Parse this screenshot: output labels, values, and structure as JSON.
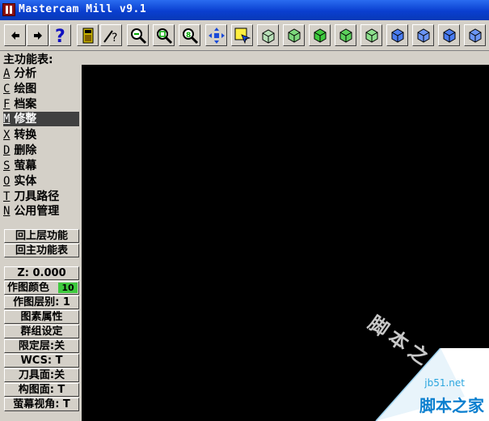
{
  "window": {
    "title": "Mastercam Mill v9.1"
  },
  "toolbar": {
    "buttons": [
      {
        "name": "back-button",
        "icon": "arrow-left-icon"
      },
      {
        "name": "forward-button",
        "icon": "arrow-right-icon"
      },
      {
        "name": "help-button",
        "icon": "question-icon"
      },
      {
        "name": "calculator-button",
        "icon": "calculator-icon"
      },
      {
        "name": "analyze-button",
        "icon": "analyze-icon"
      },
      {
        "name": "zoom-out-button",
        "icon": "zoom-out-icon"
      },
      {
        "name": "zoom-window-button",
        "icon": "zoom-window-icon"
      },
      {
        "name": "zoom-fit-button",
        "icon": "zoom-fit-icon"
      },
      {
        "name": "pan-button",
        "icon": "pan-icon"
      },
      {
        "name": "select-button",
        "icon": "select-icon"
      },
      {
        "name": "rotate-button",
        "icon": "rotate-icon"
      },
      {
        "name": "view-front-button",
        "icon": "cube-green-icon"
      },
      {
        "name": "view-top-button",
        "icon": "cube-green-icon"
      },
      {
        "name": "view-side-button",
        "icon": "cube-green-icon"
      },
      {
        "name": "view-iso-button",
        "icon": "cube-green-icon"
      },
      {
        "name": "cplane-front-button",
        "icon": "cube-blue-icon"
      },
      {
        "name": "cplane-top-button",
        "icon": "cube-blue-icon"
      },
      {
        "name": "cplane-side-button",
        "icon": "cube-blue-icon"
      },
      {
        "name": "cplane-iso-button",
        "icon": "cube-blue-icon"
      }
    ]
  },
  "menu": {
    "title": "主功能表:",
    "items": [
      {
        "key": "A",
        "label": "分析"
      },
      {
        "key": "C",
        "label": "绘图"
      },
      {
        "key": "F",
        "label": "档案"
      },
      {
        "key": "M",
        "label": "修整",
        "selected": true
      },
      {
        "key": "X",
        "label": "转换"
      },
      {
        "key": "D",
        "label": "删除"
      },
      {
        "key": "S",
        "label": "萤幕"
      },
      {
        "key": "O",
        "label": "实体"
      },
      {
        "key": "T",
        "label": "刀具路径"
      },
      {
        "key": "N",
        "label": "公用管理"
      }
    ]
  },
  "nav": {
    "back_label": "回上层功能",
    "main_label": "回主功能表"
  },
  "status": {
    "z_label": "Z:  0.000",
    "color_label": "作图颜色",
    "color_value": "10",
    "color_hex": "#3ec93e",
    "level_label": "作图层别: 1",
    "attrib_label": "图素属性",
    "group_label": "群组设定",
    "mask_label": "限定层:关",
    "wcs_label": "WCS:  T",
    "tplane_label": "刀具面:关",
    "cplane_label": "构图面: T",
    "gview_label": "萤幕视角: T"
  },
  "watermark": {
    "text": "脚本之家",
    "site": "jb51.net",
    "name": "脚本之家"
  }
}
